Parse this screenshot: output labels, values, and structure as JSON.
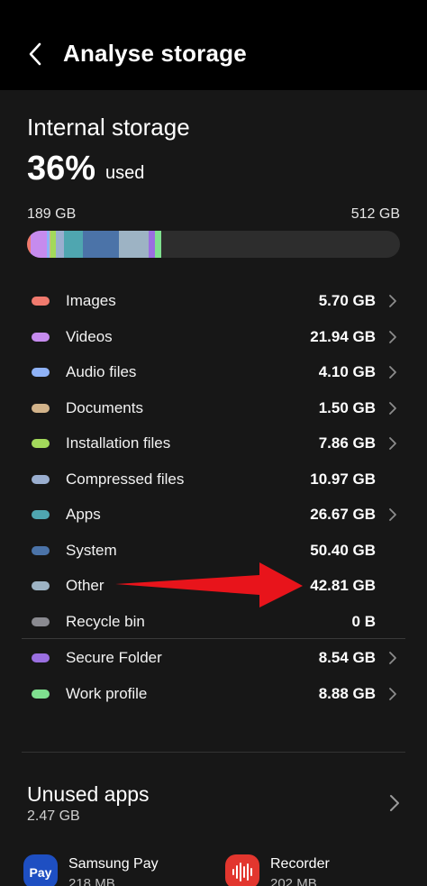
{
  "header": {
    "title": "Analyse storage",
    "back_icon": "chevron-left-icon"
  },
  "storage": {
    "title": "Internal storage",
    "percent": "36%",
    "used_label": "used",
    "used_gb": "189 GB",
    "total_gb": "512 GB",
    "used_fraction": 0.36
  },
  "categories": [
    {
      "name": "Images",
      "size": "5.70 GB",
      "color": "#F07A6E",
      "chevron": true
    },
    {
      "name": "Videos",
      "size": "21.94 GB",
      "color": "#C68BEE",
      "chevron": true
    },
    {
      "name": "Audio files",
      "size": "4.10 GB",
      "color": "#8FB2F7",
      "chevron": true
    },
    {
      "name": "Documents",
      "size": "1.50 GB",
      "color": "#D2B38A",
      "chevron": true
    },
    {
      "name": "Installation files",
      "size": "7.86 GB",
      "color": "#A3D95B",
      "chevron": true
    },
    {
      "name": "Compressed files",
      "size": "10.97 GB",
      "color": "#9AAECF",
      "chevron": false
    },
    {
      "name": "Apps",
      "size": "26.67 GB",
      "color": "#4FA6B0",
      "chevron": true
    },
    {
      "name": "System",
      "size": "50.40 GB",
      "color": "#4B73A8",
      "chevron": false
    },
    {
      "name": "Other",
      "size": "42.81 GB",
      "color": "#9DB3C4",
      "chevron": false
    },
    {
      "name": "Recycle bin",
      "size": "0 B",
      "color": "#8A8A90",
      "chevron": false
    }
  ],
  "extras": [
    {
      "name": "Secure Folder",
      "size": "8.54 GB",
      "color": "#9A6FE0",
      "chevron": true
    },
    {
      "name": "Work profile",
      "size": "8.88 GB",
      "color": "#7FE08F",
      "chevron": true
    }
  ],
  "bar_segments": [
    {
      "value": 5.7,
      "color": "#F07A6E"
    },
    {
      "value": 21.94,
      "color": "#C68BEE"
    },
    {
      "value": 4.1,
      "color": "#8FB2F7"
    },
    {
      "value": 1.5,
      "color": "#D2B38A"
    },
    {
      "value": 7.86,
      "color": "#A3D95B"
    },
    {
      "value": 10.97,
      "color": "#9AAECF"
    },
    {
      "value": 26.67,
      "color": "#4FA6B0"
    },
    {
      "value": 50.4,
      "color": "#4B73A8"
    },
    {
      "value": 42.81,
      "color": "#9DB3C4"
    },
    {
      "value": 8.54,
      "color": "#9A6FE0"
    },
    {
      "value": 8.88,
      "color": "#7FE08F"
    }
  ],
  "annotation": {
    "arrow_color": "#E8141B"
  },
  "unused_apps": {
    "title": "Unused apps",
    "size": "2.47 GB",
    "apps": [
      {
        "name": "Samsung Pay",
        "size": "218 MB",
        "icon_label": "Pay",
        "icon_color": "#1E4FC2"
      },
      {
        "name": "Recorder",
        "size": "202 MB",
        "icon_color": "#E2362E"
      }
    ]
  }
}
